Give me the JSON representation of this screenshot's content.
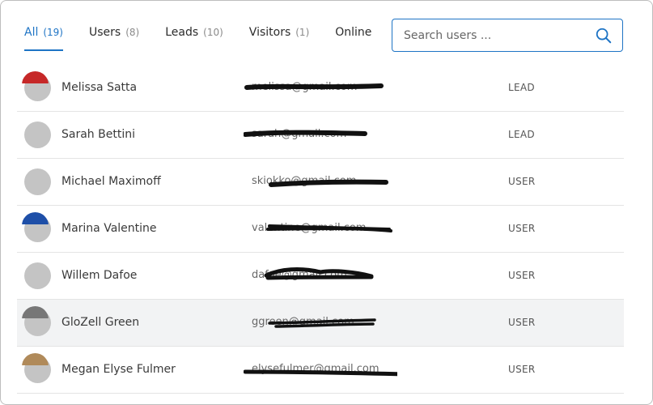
{
  "tabs": [
    {
      "label": "All",
      "count": "(19)",
      "active": true
    },
    {
      "label": "Users",
      "count": "(8)",
      "active": false
    },
    {
      "label": "Leads",
      "count": "(10)",
      "active": false
    },
    {
      "label": "Visitors",
      "count": "(1)",
      "active": false
    },
    {
      "label": "Online",
      "count": "",
      "active": false
    }
  ],
  "search": {
    "placeholder": "Search users ...",
    "icon": "search-icon"
  },
  "users": [
    {
      "name": "Melissa Satta",
      "email": "melissa@gmail.com",
      "role": "LEAD",
      "ring_color": "#c62828"
    },
    {
      "name": "Sarah Bettini",
      "email": "sarah@gmail.com",
      "role": "LEAD",
      "ring_color": ""
    },
    {
      "name": "Michael Maximoff",
      "email": "skiokko@gmail.com",
      "role": "USER",
      "ring_color": ""
    },
    {
      "name": "Marina Valentine",
      "email": "valentine@gmail.com",
      "role": "USER",
      "ring_color": "#1e4fa8"
    },
    {
      "name": "Willem Dafoe",
      "email": "dafoe@gmail.com",
      "role": "USER",
      "ring_color": ""
    },
    {
      "name": "GloZell Green",
      "email": "ggreen@gmail.com",
      "role": "USER",
      "ring_color": "#777777"
    },
    {
      "name": "Megan Elyse Fulmer",
      "email": "elysefulmer@gmail.com",
      "role": "USER",
      "ring_color": "#b08a5a"
    }
  ],
  "colors": {
    "accent": "#1e74c5",
    "hover_row": "#f2f3f4"
  }
}
